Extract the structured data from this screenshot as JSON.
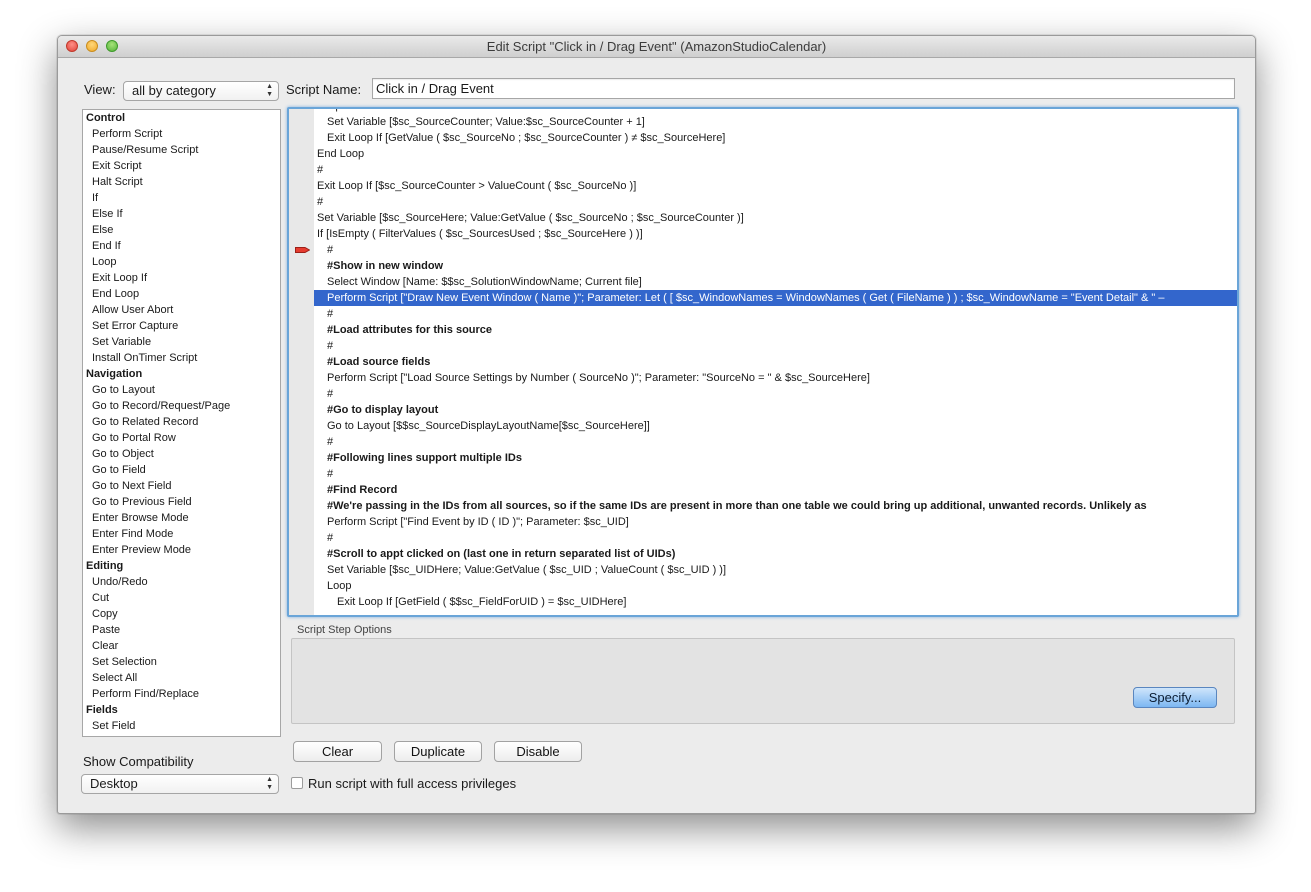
{
  "window": {
    "title": "Edit Script \"Click in / Drag Event\" (AmazonStudioCalendar)"
  },
  "view": {
    "label": "View:",
    "selected": "all by category"
  },
  "script_name": {
    "label": "Script Name:",
    "value": "Click in / Drag Event"
  },
  "steps_list": [
    {
      "type": "category",
      "label": "Control"
    },
    {
      "type": "item",
      "label": "Perform Script"
    },
    {
      "type": "item",
      "label": "Pause/Resume Script"
    },
    {
      "type": "item",
      "label": "Exit Script"
    },
    {
      "type": "item",
      "label": "Halt Script"
    },
    {
      "type": "item",
      "label": "If"
    },
    {
      "type": "item",
      "label": "Else If"
    },
    {
      "type": "item",
      "label": "Else"
    },
    {
      "type": "item",
      "label": "End If"
    },
    {
      "type": "item",
      "label": "Loop"
    },
    {
      "type": "item",
      "label": "Exit Loop If"
    },
    {
      "type": "item",
      "label": "End Loop"
    },
    {
      "type": "item",
      "label": "Allow User Abort"
    },
    {
      "type": "item",
      "label": "Set Error Capture"
    },
    {
      "type": "item",
      "label": "Set Variable"
    },
    {
      "type": "item",
      "label": "Install OnTimer Script"
    },
    {
      "type": "category",
      "label": "Navigation"
    },
    {
      "type": "item",
      "label": "Go to Layout"
    },
    {
      "type": "item",
      "label": "Go to Record/Request/Page"
    },
    {
      "type": "item",
      "label": "Go to Related Record"
    },
    {
      "type": "item",
      "label": "Go to Portal Row"
    },
    {
      "type": "item",
      "label": "Go to Object"
    },
    {
      "type": "item",
      "label": "Go to Field"
    },
    {
      "type": "item",
      "label": "Go to Next Field"
    },
    {
      "type": "item",
      "label": "Go to Previous Field"
    },
    {
      "type": "item",
      "label": "Enter Browse Mode"
    },
    {
      "type": "item",
      "label": "Enter Find Mode"
    },
    {
      "type": "item",
      "label": "Enter Preview Mode"
    },
    {
      "type": "category",
      "label": "Editing"
    },
    {
      "type": "item",
      "label": "Undo/Redo"
    },
    {
      "type": "item",
      "label": "Cut"
    },
    {
      "type": "item",
      "label": "Copy"
    },
    {
      "type": "item",
      "label": "Paste"
    },
    {
      "type": "item",
      "label": "Clear"
    },
    {
      "type": "item",
      "label": "Set Selection"
    },
    {
      "type": "item",
      "label": "Select All"
    },
    {
      "type": "item",
      "label": "Perform Find/Replace"
    },
    {
      "type": "category",
      "label": "Fields"
    },
    {
      "type": "item",
      "label": "Set Field"
    }
  ],
  "script_lines": [
    {
      "indent": 1,
      "text": "Loop"
    },
    {
      "indent": 2,
      "text": "Set Variable [$sc_SourceCounter; Value:$sc_SourceCounter + 1]"
    },
    {
      "indent": 2,
      "text": "Exit Loop If [GetValue ( $sc_SourceNo ; $sc_SourceCounter ) ≠ $sc_SourceHere]"
    },
    {
      "indent": 1,
      "text": "End Loop"
    },
    {
      "indent": 1,
      "text": "#"
    },
    {
      "indent": 1,
      "text": "Exit Loop If [$sc_SourceCounter > ValueCount ( $sc_SourceNo )]"
    },
    {
      "indent": 1,
      "text": "#"
    },
    {
      "indent": 1,
      "text": "Set Variable [$sc_SourceHere; Value:GetValue ( $sc_SourceNo ; $sc_SourceCounter )]"
    },
    {
      "indent": 1,
      "text": "If [IsEmpty ( FilterValues ( $sc_SourcesUsed ; $sc_SourceHere ) )]"
    },
    {
      "indent": 2,
      "text": "#",
      "breakpoint": true
    },
    {
      "indent": 2,
      "text": "#Show in new window",
      "bold": true
    },
    {
      "indent": 2,
      "text": "Select Window [Name: $$sc_SolutionWindowName; Current file]"
    },
    {
      "indent": 2,
      "text": "Perform Script [\"Draw New Event Window ( Name )\"; Parameter: Let ( [ $sc_WindowNames = WindowNames ( Get ( FileName ) ) ; $sc_WindowName = \"Event Detail\" & \"  – ",
      "selected": true
    },
    {
      "indent": 2,
      "text": "#"
    },
    {
      "indent": 2,
      "text": "#Load attributes for this source",
      "bold": true
    },
    {
      "indent": 2,
      "text": "#"
    },
    {
      "indent": 2,
      "text": "#Load source fields",
      "bold": true
    },
    {
      "indent": 2,
      "text": "Perform Script [\"Load Source Settings by Number ( SourceNo )\"; Parameter: \"SourceNo = \" & $sc_SourceHere]"
    },
    {
      "indent": 2,
      "text": "#"
    },
    {
      "indent": 2,
      "text": "#Go to display layout",
      "bold": true
    },
    {
      "indent": 2,
      "text": "Go to Layout [$$sc_SourceDisplayLayoutName[$sc_SourceHere]]"
    },
    {
      "indent": 2,
      "text": "#"
    },
    {
      "indent": 2,
      "text": "#Following lines support multiple IDs",
      "bold": true
    },
    {
      "indent": 2,
      "text": "#"
    },
    {
      "indent": 2,
      "text": "#Find Record",
      "bold": true
    },
    {
      "indent": 2,
      "text": "#We're passing in the IDs from all sources, so if the same IDs are present in more than one table we could bring up additional, unwanted records. Unlikely as",
      "bold": true
    },
    {
      "indent": 2,
      "text": "Perform Script [\"Find Event by ID ( ID )\"; Parameter: $sc_UID]"
    },
    {
      "indent": 2,
      "text": "#"
    },
    {
      "indent": 2,
      "text": "#Scroll to appt clicked on (last one in return separated list of UIDs)",
      "bold": true
    },
    {
      "indent": 2,
      "text": "Set Variable [$sc_UIDHere; Value:GetValue ( $sc_UID ; ValueCount ( $sc_UID ) )]"
    },
    {
      "indent": 2,
      "text": "Loop"
    },
    {
      "indent": 3,
      "text": "Exit Loop If [GetField ( $$sc_FieldForUID ) = $sc_UIDHere]"
    }
  ],
  "step_options": {
    "label": "Script Step Options",
    "specify_label": "Specify..."
  },
  "buttons": {
    "clear": "Clear",
    "duplicate": "Duplicate",
    "disable": "Disable"
  },
  "compatibility": {
    "label": "Show Compatibility",
    "selected": "Desktop"
  },
  "full_access": {
    "label": "Run script with full access privileges",
    "checked": false
  },
  "colors": {
    "selection": "#3366cc",
    "focus_ring": "#6aa5d8",
    "default_button": "#7db7f2"
  }
}
